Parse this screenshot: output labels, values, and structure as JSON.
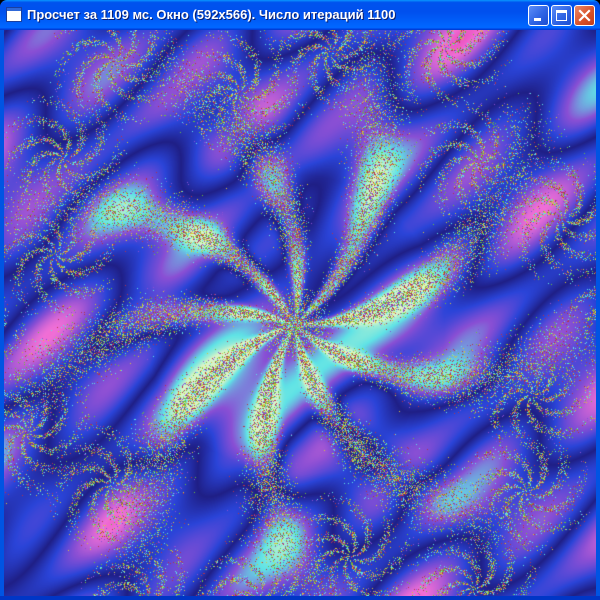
{
  "window": {
    "title": "Просчет за 1109 мс. Окно (592x566). Число итераций 1100",
    "icon": "app-window-icon",
    "controls": {
      "minimize_icon": "minimize-icon",
      "maximize_icon": "maximize-icon",
      "close_icon": "close-icon"
    }
  },
  "fractal": {
    "kind": "Julia set",
    "arms": 9,
    "iterations": 1100,
    "render_time_ms": 1109,
    "palette": {
      "deep": "#1f1f86",
      "blue": "#2a44d8",
      "violet": "#8a4fd4",
      "magenta": "#e21a96",
      "pink": "#f06fd6",
      "cyan": "#5fe3e6",
      "pale": "#d6f4c8",
      "filament_green": "#6bbf3a",
      "filament_red": "#b4324a",
      "filament_yellow": "#d8c43a"
    }
  },
  "colors": {
    "title_bar": "#0058ee",
    "close_button": "#d9522a",
    "frame": "#0054e3"
  }
}
